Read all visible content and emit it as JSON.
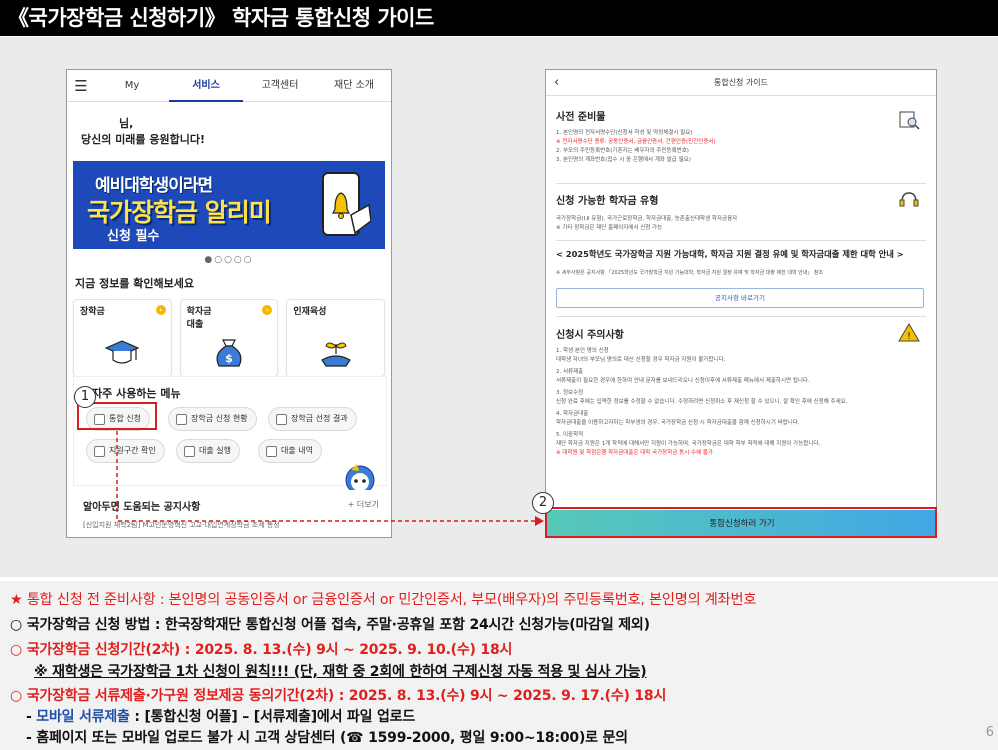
{
  "title": "《국가장학금 신청하기》 학자금 통합신청 가이드",
  "left_phone": {
    "nav": [
      "My",
      "서비스",
      "고객센터",
      "재단 소개"
    ],
    "greeting_line1": "님,",
    "greeting_line2": "당신의 미래를 응원합니다!",
    "banner": {
      "line1": "예비대학생이라면",
      "line2": "국가장학금 알리미",
      "line3": "신청 필수"
    },
    "dots": "●○○○○",
    "section_title": "지금 정보를 확인해보세요",
    "cards": [
      {
        "label": "장학금",
        "icon": "graduation-cap-icon"
      },
      {
        "label": "학자금\n대출",
        "icon": "money-bag-icon"
      },
      {
        "label": "인재육성",
        "icon": "plant-hand-icon"
      }
    ],
    "freq_title": "자주 사용하는 메뉴",
    "pills": [
      "통합 신청",
      "장학금 신청 현황",
      "장학금 선정 결과",
      "지원구간 확인",
      "대출 실행",
      "대출 내역"
    ],
    "notice_title": "알아두면 도움되는 공지사항",
    "notice_more": "+ 더보기",
    "notice_line": "[신입지원 재학2팀] M고인운영혁신 고교·대입연계장학금 조세 통정"
  },
  "right_phone": {
    "header": "통합신청 가이드",
    "sec1_title": "사전 준비물",
    "sec1_lines": [
      "1. 본인명의 전자서명수단(신청서 작성 및 약정체결시 필요)",
      "※ 전자서명수단 종류: 공동인증서, 금융인증서, 간편인증(민간인증서)",
      "2. 부모의 주민등록번호(기혼자는 배우자의 주민등록번호)",
      "3. 본인명의 계좌번호(접수 시 응 은행에서 계좌 발급 필요)"
    ],
    "sec2_title": "신청 가능한 학자금 유형",
    "sec2_lines": [
      "국가장학금(Ⅰ,Ⅱ 유형), 국가근로장학금, 학자금대출, 농촌출신대학생 학자금융자",
      "※ 기타 장학금은 재단 홈페이지에서 신청 가능"
    ],
    "sec3_title": "< 2025학년도 국가장학금 지원 가능대학, 학자금 지원 결정 유예 및 학자금대출 제한 대학 안내 >",
    "sec3_line": "※ 세부사항은 공지사항 「2025학년도 국가장학금 지원 가능대학, 학자금 지원 결정 유예 및 학자금 대출 제한 대학 안내」 참조",
    "sec3_button": "공지사항 바로가기",
    "sec4_title": "신청시 주의사항",
    "sec4_lines": [
      "1. 학생 본인 명의 신청",
      "대학생 자녀의 부모님 명의로 대신 신청할 경우 학자금 지원이 불가합니다.",
      "2. 서류제출",
      "서류제출이 필요한 경우에 한하여 안내 문자를 보내드리오니 신청이후에 서류제출 메뉴에서 제출하시면 됩니다.",
      "3. 정보수정",
      "신청 완료 후에는 입력한 정보를 수정할 수 없습니다. 수정하려면 신청취소 후 재신청 할 수 있으니, 잘 확인 후에 신청해 주세요.",
      "4. 학자금대출",
      "학자금대출을 이용하고자하는 학부생의 경우, 국가장학금 신청 시 학자금대출을 함께 신청하시기 바랍니다.",
      "5. 이중학적",
      "재단 학자금 지원은 1개 학적에 대해서만 지원이 가능하며, 국가장학금은 대학 학부 학적에 대해 지원이 가능합니다.",
      "※ 대학원 및 학점은행 학자금대출은 대학 국가장학금 동시 수혜 불가"
    ],
    "bottom_button": "통합신청하러 가기"
  },
  "callouts": [
    "1",
    "2"
  ],
  "notes": {
    "n1": "★ 통합 신청 전 준비사항 : 본인명의 공동인증서 or 금융인증서 or 민간인증서,  부모(배우자)의 주민등록번호, 본인명의 계좌번호",
    "n2": "○ 국가장학금 신청 방법 : 한국장학재단 통합신청 어플 접속, 주말·공휴일 포함 24시간 신청가능(마감일 제외)",
    "n3": "○ 국가장학금 신청기간(2차) : 2025. 8. 13.(수) 9시 ~ 2025. 9. 10.(수) 18시",
    "n4": "※ 재학생은 국가장학금 1차 신청이 원칙!!! (단, 재학 중 2회에 한하여 구제신청 자동 적용 및 심사 가능)",
    "n5": "○ 국가장학금 서류제출·가구원 정보제공 동의기간(2차) : 2025. 8. 13.(수) 9시 ~ 2025. 9. 17.(수) 18시",
    "n6_prefix": "- ",
    "n6_blue": "모바일 서류제출",
    "n6_rest": " : [통합신청 어플] – [서류제출]에서 파일 업로드",
    "n7": "- 홈페이지 또는 모바일 업로드 불가 시 고객 상담센터 (☎ 1599-2000, 평일 9:00~18:00)로 문의"
  },
  "page_number": "6"
}
